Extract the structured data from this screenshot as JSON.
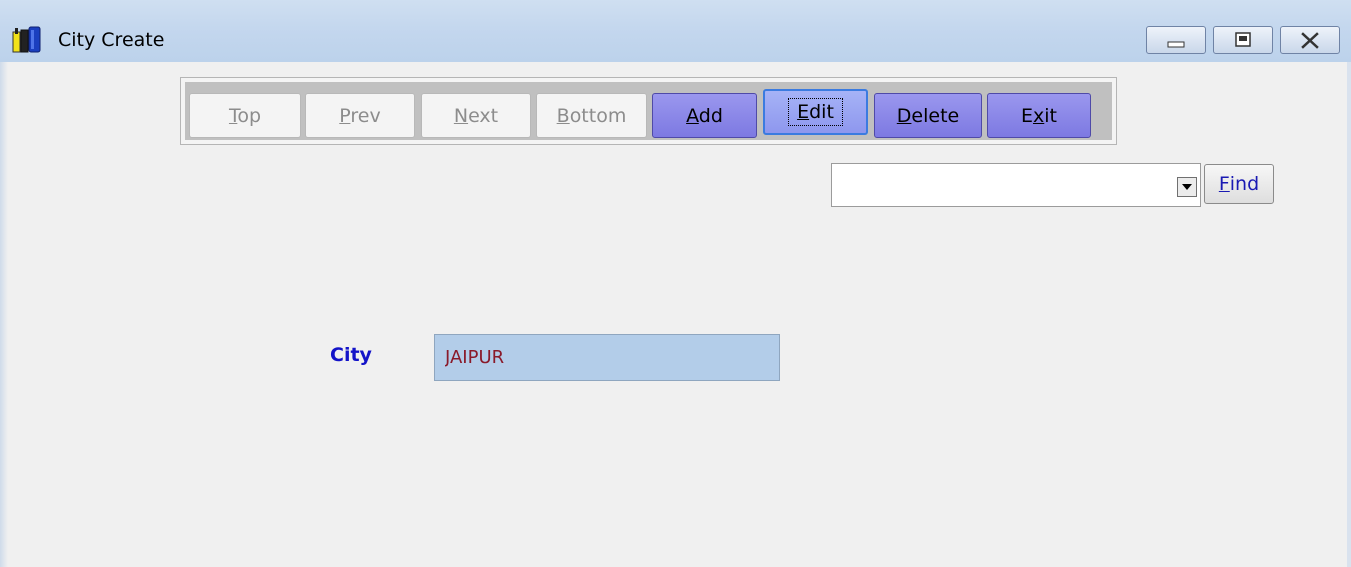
{
  "window": {
    "title": "City Create",
    "controls": {
      "minimize": "minimize-icon",
      "restore": "restore-icon",
      "close": "close-icon"
    }
  },
  "toolbar": {
    "buttons": [
      {
        "pre": "",
        "accel": "T",
        "post": "op",
        "state": "disabled"
      },
      {
        "pre": "",
        "accel": "P",
        "post": "rev",
        "state": "disabled"
      },
      {
        "pre": "",
        "accel": "N",
        "post": "ext",
        "state": "disabled"
      },
      {
        "pre": "",
        "accel": "B",
        "post": "ottom",
        "state": "disabled"
      },
      {
        "pre": "",
        "accel": "A",
        "post": "dd",
        "state": "enabled"
      },
      {
        "pre": "",
        "accel": "E",
        "post": "dit",
        "state": "focused"
      },
      {
        "pre": "",
        "accel": "D",
        "post": "elete",
        "state": "enabled"
      },
      {
        "pre": "E",
        "accel": "x",
        "post": "it",
        "state": "enabled"
      }
    ]
  },
  "search": {
    "selected_value": "",
    "find_accel": "F",
    "find_rest": "ind"
  },
  "form": {
    "city_label": "City",
    "city_value": "JAIPUR"
  },
  "colors": {
    "title_bar": "#c4d7ee",
    "active_button": "#8985e8",
    "field_label": "#1313c8",
    "field_bg": "#b3cde9",
    "field_text": "#8a1a2a"
  }
}
